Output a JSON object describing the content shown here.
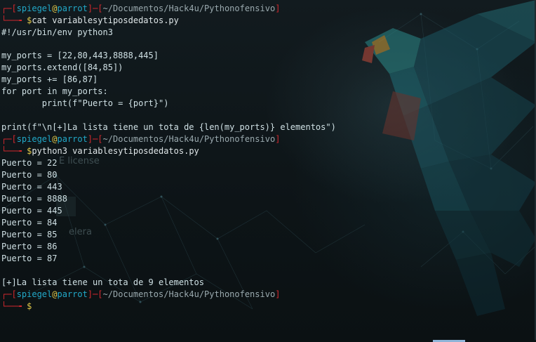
{
  "prompt": {
    "user": "spiegel",
    "at": "@",
    "host": "parrot",
    "path": "~/Documentos/Hack4u/Pythonofensivo",
    "symbol": "$"
  },
  "commands": {
    "first": "cat variablesytiposdedatos.py",
    "second": "python3 variablesytiposdedatos.py"
  },
  "file_lines": [
    "#!/usr/bin/env python3",
    "",
    "my_ports = [22,80,443,8888,445]",
    "my_ports.extend([84,85])",
    "my_ports += [86,87]",
    "for port in my_ports:",
    "        print(f\"Puerto = {port}\")",
    "",
    "print(f\"\\n[+]La lista tiene un tota de {len(my_ports)} elementos\")"
  ],
  "output_lines": [
    "Puerto = 22",
    "Puerto = 80",
    "Puerto = 443",
    "Puerto = 8888",
    "Puerto = 445",
    "Puerto = 84",
    "Puerto = 85",
    "Puerto = 86",
    "Puerto = 87",
    "",
    "[+]La lista tiene un tota de 9 elementos"
  ],
  "background_text": {
    "license": "E license",
    "other": "elera"
  },
  "colors": {
    "prompt_bracket": "#d3282e",
    "host": "#22a9c9",
    "at": "#e2c94a",
    "background": "#0e1518"
  }
}
